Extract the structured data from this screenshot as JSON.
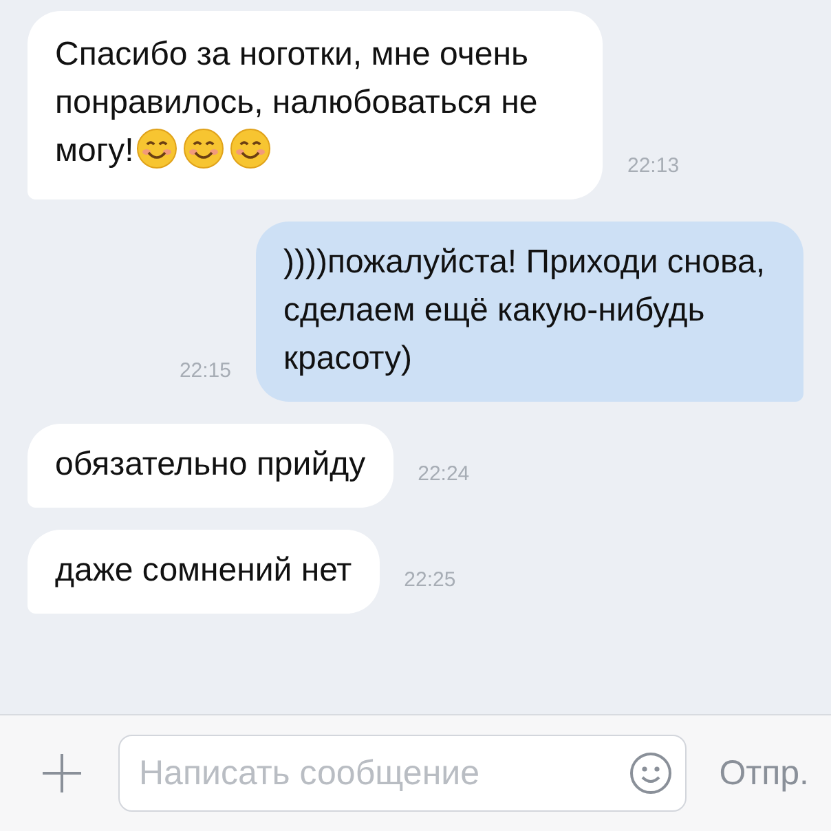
{
  "messages": [
    {
      "kind": "incoming",
      "text": "Спасибо за ноготки, мне очень понравилось, налюбоваться не могу!",
      "emojis": [
        {
          "kind": "smile"
        },
        {
          "kind": "smile"
        },
        {
          "kind": "smile"
        }
      ],
      "time": "22:13"
    },
    {
      "kind": "outgoing",
      "text": "))))пожалуйста! Приходи снова, сделаем ещё какую-нибудь красоту)",
      "time": "22:15"
    },
    {
      "kind": "incoming",
      "text": "обязательно прийду",
      "time": "22:24"
    },
    {
      "kind": "incoming",
      "text": "даже сомнений нет",
      "time": "22:25"
    }
  ],
  "composer": {
    "placeholder": "Написать сообщение",
    "send": "Отпр."
  }
}
